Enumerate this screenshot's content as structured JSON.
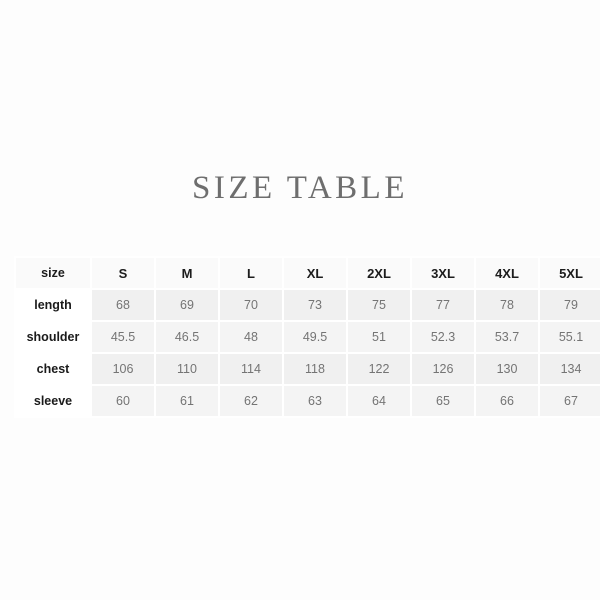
{
  "header": {
    "title": "SIZE TABLE"
  },
  "table": {
    "columns": [
      "size",
      "S",
      "M",
      "L",
      "XL",
      "2XL",
      "3XL",
      "4XL",
      "5XL"
    ],
    "rows": [
      {
        "label": "length",
        "values": [
          "68",
          "69",
          "70",
          "73",
          "75",
          "77",
          "78",
          "79"
        ]
      },
      {
        "label": "shoulder",
        "values": [
          "45.5",
          "46.5",
          "48",
          "49.5",
          "51",
          "52.3",
          "53.7",
          "55.1"
        ]
      },
      {
        "label": "chest",
        "values": [
          "106",
          "110",
          "114",
          "118",
          "122",
          "126",
          "130",
          "134"
        ]
      },
      {
        "label": "sleeve",
        "values": [
          "60",
          "61",
          "62",
          "63",
          "64",
          "65",
          "66",
          "67"
        ]
      }
    ]
  },
  "colors": {
    "page_background": "#fdfdfd",
    "title_text": "#6e6e6e",
    "header_cell_background": "#fafafa",
    "header_cell_text": "#1c1c1c",
    "row_label_background": "#ffffff",
    "row_label_text": "#1b1b1b",
    "value_cell_background": "#f0f0f0",
    "value_cell_text": "#747474",
    "grid_line": "#ffffff"
  }
}
